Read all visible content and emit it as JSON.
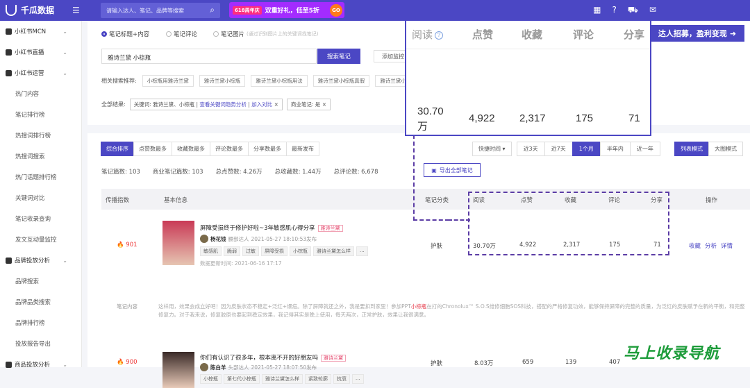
{
  "topbar": {
    "app_name": "千瓜数据",
    "search_placeholder": "请输入达人、笔记、品牌等搜索",
    "banner": {
      "badge": "618周年庆",
      "text": "双重好礼，低至5折",
      "go": "GO"
    }
  },
  "sidebar": {
    "items": [
      {
        "label": "小红书MCN",
        "type": "group"
      },
      {
        "label": "小红书直播",
        "type": "group"
      },
      {
        "label": "小红书运营",
        "type": "group"
      },
      {
        "label": "热门内容",
        "type": "sub"
      },
      {
        "label": "笔记排行榜",
        "type": "sub"
      },
      {
        "label": "热搜词排行榜",
        "type": "sub"
      },
      {
        "label": "热搜词搜索",
        "type": "sub"
      },
      {
        "label": "热门话题排行榜",
        "type": "sub"
      },
      {
        "label": "关键词对比",
        "type": "sub"
      },
      {
        "label": "笔记收录查询",
        "type": "sub"
      },
      {
        "label": "发文互动量监控",
        "type": "sub"
      },
      {
        "label": "品牌投放分析",
        "type": "group"
      },
      {
        "label": "品牌搜索",
        "type": "sub"
      },
      {
        "label": "品牌品类搜索",
        "type": "sub"
      },
      {
        "label": "品牌排行榜",
        "type": "sub"
      },
      {
        "label": "投放报告导出",
        "type": "sub"
      },
      {
        "label": "商品投放分析",
        "type": "group"
      }
    ]
  },
  "filters": {
    "radios": [
      "笔记标题+内容",
      "笔记评论",
      "笔记图片"
    ],
    "radio_hint": "(通过识别图片上的关键词找笔记)",
    "keyword": "雅诗兰黛 小棕瓶",
    "search_button": "搜索笔记",
    "add_button": "添加监控",
    "related_label": "相关搜索推荐:",
    "related": [
      "小棕瓶用雅诗兰黛",
      "雅诗兰黛小棕瓶",
      "雅诗兰黛小棕瓶用法",
      "雅诗兰黛小棕瓶真假",
      "雅诗兰黛小棕瓶"
    ],
    "all_results_label": "全部结果:",
    "keyword_chip": "关键词: 雅诗兰黛、小棕瓶",
    "keyword_chip_link": "查看关键词趋势分析",
    "keyword_chip_link2": "加入对比",
    "business_chip": "商业笔记: 是"
  },
  "sorts": [
    "综合排序",
    "点赞数最多",
    "收藏数最多",
    "评论数最多",
    "分享数最多",
    "最新发布"
  ],
  "time_dropdown": "快捷时间",
  "ranges": [
    "近3天",
    "近7天",
    "1个月",
    "半年内",
    "近一年"
  ],
  "modes": [
    "列表模式",
    "大图模式"
  ],
  "stats": [
    "笔记篇数: 103",
    "商业笔记篇数: 103",
    "总点赞数: 4.26万",
    "总收藏数: 1.44万",
    "总评论数: 6,678"
  ],
  "export_label": "导出全部笔记",
  "table": {
    "headers": {
      "spread": "传播指数",
      "info": "基本信息",
      "category": "笔记分类",
      "reads": "阅读",
      "likes": "点赞",
      "favs": "收藏",
      "comments": "评论",
      "shares": "分享",
      "ops": "操作"
    },
    "rows": [
      {
        "heat": "901",
        "title": "屏障受损终于修护好啦~3年敏感肌心得分享",
        "kw": "雅诗兰黛",
        "author": "杨花钱",
        "author_level": "腰部达人",
        "published": "2021-05-27 18:10:53发布",
        "tags": [
          "敏感肌",
          "脆弱",
          "过敏",
          "屏障受损",
          "小棕瓶",
          "雅诗兰黛怎么样"
        ],
        "updated": "数据更新时间: 2021-06-16 17:17",
        "category": "护肤",
        "reads": "30.70万",
        "likes": "4,922",
        "favs": "2,317",
        "comments": "175",
        "shares": "71",
        "ops": [
          "收藏",
          "分析",
          "详情"
        ]
      },
      {
        "heat": "900",
        "title": "你们有认识了很多年，根本离不开的好朋友吗",
        "kw": "雅诗兰黛",
        "author": "陈白羊",
        "author_level": "头部达人",
        "published": "2021-05-27 18:07:50发布",
        "tags": [
          "小棕瓶",
          "第七代小棕瓶",
          "雅诗兰黛怎么样",
          "紧致轮廓",
          "抗衰"
        ],
        "category": "护肤",
        "reads": "8.03万",
        "likes": "659",
        "favs": "139",
        "comments": "407",
        "shares": ""
      }
    ],
    "content_label": "笔记内容",
    "content_text_a": "这样用，效果会成立好吧！因为皮肤状态不稳定+泛红+爆痘。除了屏障就还之外，我是要扣到家里！参加PPT",
    "content_text_hl": "小棕瓶",
    "content_text_b": "在打的Chronolux™ S.O.S维修细胞SOS科技，搭配的严格修复功效，能够保持屏障的完整的质量，为泛红的皮肤赋予在新的平衡，和完整修复力。对于我来说，修复胶原也要起到稳定效果，我记得其实是晚上使用，每天两次，正常护肤，效果让我很满意。"
  },
  "popup": {
    "headers": [
      "阅读",
      "点赞",
      "收藏",
      "评论",
      "分享"
    ],
    "values": [
      "30.70万",
      "4,922",
      "2,317",
      "175",
      "71"
    ]
  },
  "recruit": "达人招募，盈利变现",
  "watermark": "马上收录导航"
}
